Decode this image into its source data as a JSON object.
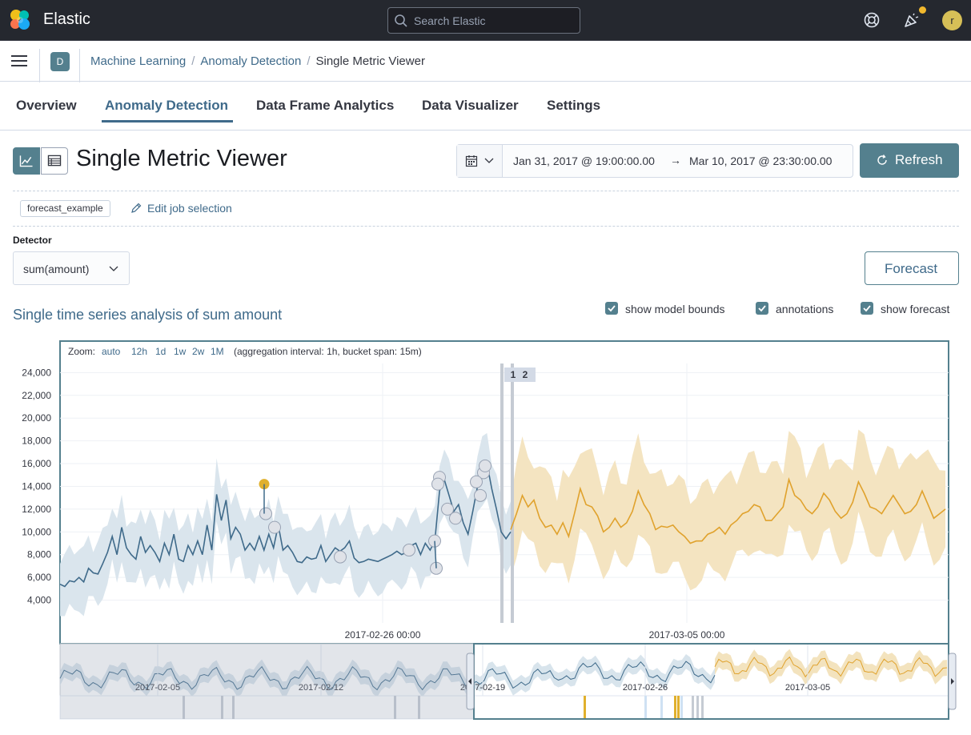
{
  "header": {
    "brand": "Elastic",
    "search_placeholder": "Search Elastic",
    "avatar_initial": "r"
  },
  "breadcrumb": {
    "space_initial": "D",
    "items": [
      "Machine Learning",
      "Anomaly Detection",
      "Single Metric Viewer"
    ]
  },
  "tabs": [
    {
      "label": "Overview",
      "active": false
    },
    {
      "label": "Anomaly Detection",
      "active": true
    },
    {
      "label": "Data Frame Analytics",
      "active": false
    },
    {
      "label": "Data Visualizer",
      "active": false
    },
    {
      "label": "Settings",
      "active": false
    }
  ],
  "page": {
    "title": "Single Metric Viewer",
    "time_start": "Jan 31, 2017 @ 19:00:00.00",
    "time_end": "Mar 10, 2017 @ 23:30:00.00",
    "refresh_label": "Refresh",
    "job_id": "forecast_example",
    "edit_job_label": "Edit job selection",
    "detector_label": "Detector",
    "detector_value": "sum(amount)",
    "forecast_label": "Forecast",
    "series_title": "Single time series analysis of sum amount",
    "checkboxes": [
      {
        "label": "show model bounds",
        "checked": true
      },
      {
        "label": "annotations",
        "checked": true
      },
      {
        "label": "show forecast",
        "checked": true
      }
    ]
  },
  "chart_data": {
    "type": "line",
    "zoom_label": "Zoom:",
    "zoom_options": [
      "auto",
      "12h",
      "1d",
      "1w",
      "2w",
      "1M"
    ],
    "aggregation_note": "(aggregation interval: 1h, bucket span: 15m)",
    "y_ticks": [
      4000,
      6000,
      8000,
      10000,
      12000,
      14000,
      16000,
      18000,
      20000,
      22000,
      24000
    ],
    "y_tick_labels": [
      "4,000",
      "6,000",
      "8,000",
      "10,000",
      "12,000",
      "14,000",
      "16,000",
      "18,000",
      "20,000",
      "22,000",
      "24,000"
    ],
    "ylim": [
      2000,
      24800
    ],
    "x_tick_labels": [
      "2017-02-26 00:00",
      "2017-03-05 00:00"
    ],
    "annotation_labels": [
      "1",
      "2"
    ],
    "context_tick_labels": [
      "2017-02-05",
      "2017-02-12",
      "2017-02-19",
      "2017-02-26",
      "2017-03-05"
    ],
    "colors": {
      "actual": "#3f6a8a",
      "model_bounds": "#d8e4ec",
      "forecast": "#e0a22d",
      "forecast_bounds": "#f3e3be",
      "anomaly_critical": "#e0b02d",
      "anomaly_low": "#dfe2e8"
    },
    "series": [
      {
        "role": "actual",
        "values": [
          5400,
          5200,
          5700,
          5600,
          6000,
          5600,
          6800,
          6400,
          6300,
          7200,
          8200,
          9600,
          8000,
          10400,
          8600,
          8000,
          7600,
          9600,
          8200,
          8800,
          8200,
          7400,
          9000,
          8000,
          9800,
          7600,
          7400,
          8800,
          8000,
          9200,
          8000,
          10600,
          8400,
          13300,
          11000,
          12800,
          9400,
          10400,
          9800,
          8400,
          9000,
          8400,
          9600,
          8400,
          9800,
          8600,
          10600,
          8400,
          8800,
          8200,
          7400,
          7300,
          7800,
          7600,
          7700,
          8800,
          7400,
          8000,
          8600,
          8300,
          8600,
          9200,
          7700,
          7300,
          7400,
          7600,
          7500,
          7400,
          7600,
          7800,
          8000,
          8300,
          8000,
          8200,
          8800,
          9000,
          8000,
          9000,
          8400,
          9200,
          13600,
          14600,
          13200,
          11800,
          12400,
          10800,
          9800,
          11800,
          14000,
          15200,
          16000,
          13800,
          12000,
          10000,
          9400,
          10000
        ],
        "forecast_values": [
          10200,
          11600,
          13200,
          12200,
          12800,
          11200,
          10400,
          10600,
          9800,
          10800,
          9600,
          11600,
          13800,
          12400,
          12200,
          11400,
          10000,
          10400,
          11200,
          10400,
          10800,
          11800,
          13600,
          12400,
          11600,
          10200,
          10500,
          10400,
          10600,
          10000,
          9600,
          9000,
          9200,
          9200,
          9800,
          10000,
          10400,
          9800,
          10600,
          11000,
          11600,
          11800,
          12400,
          12200,
          11000,
          11000,
          11600,
          12200,
          14600,
          13200,
          12800,
          12000,
          11600,
          12200,
          13400,
          12800,
          11800,
          11200,
          11600,
          12600,
          14400,
          13400,
          12200,
          12000,
          11600,
          12400,
          13200,
          12400,
          11600,
          11800,
          12400,
          13600,
          12400,
          11200,
          11600,
          12000
        ]
      }
    ],
    "anomalies": [
      {
        "value": 14200,
        "severity": "critical"
      },
      {
        "value": 11600,
        "severity": "low"
      },
      {
        "value": 10400,
        "severity": "low"
      },
      {
        "value": 7800,
        "severity": "low"
      },
      {
        "value": 8400,
        "severity": "low"
      },
      {
        "value": 9200,
        "severity": "low"
      },
      {
        "value": 6800,
        "severity": "low"
      },
      {
        "value": 14800,
        "severity": "low"
      },
      {
        "value": 14200,
        "severity": "low"
      },
      {
        "value": 12000,
        "severity": "low"
      },
      {
        "value": 11200,
        "severity": "low"
      },
      {
        "value": 15200,
        "severity": "low"
      },
      {
        "value": 14400,
        "severity": "low"
      },
      {
        "value": 13200,
        "severity": "low"
      },
      {
        "value": 15800,
        "severity": "low"
      }
    ]
  }
}
